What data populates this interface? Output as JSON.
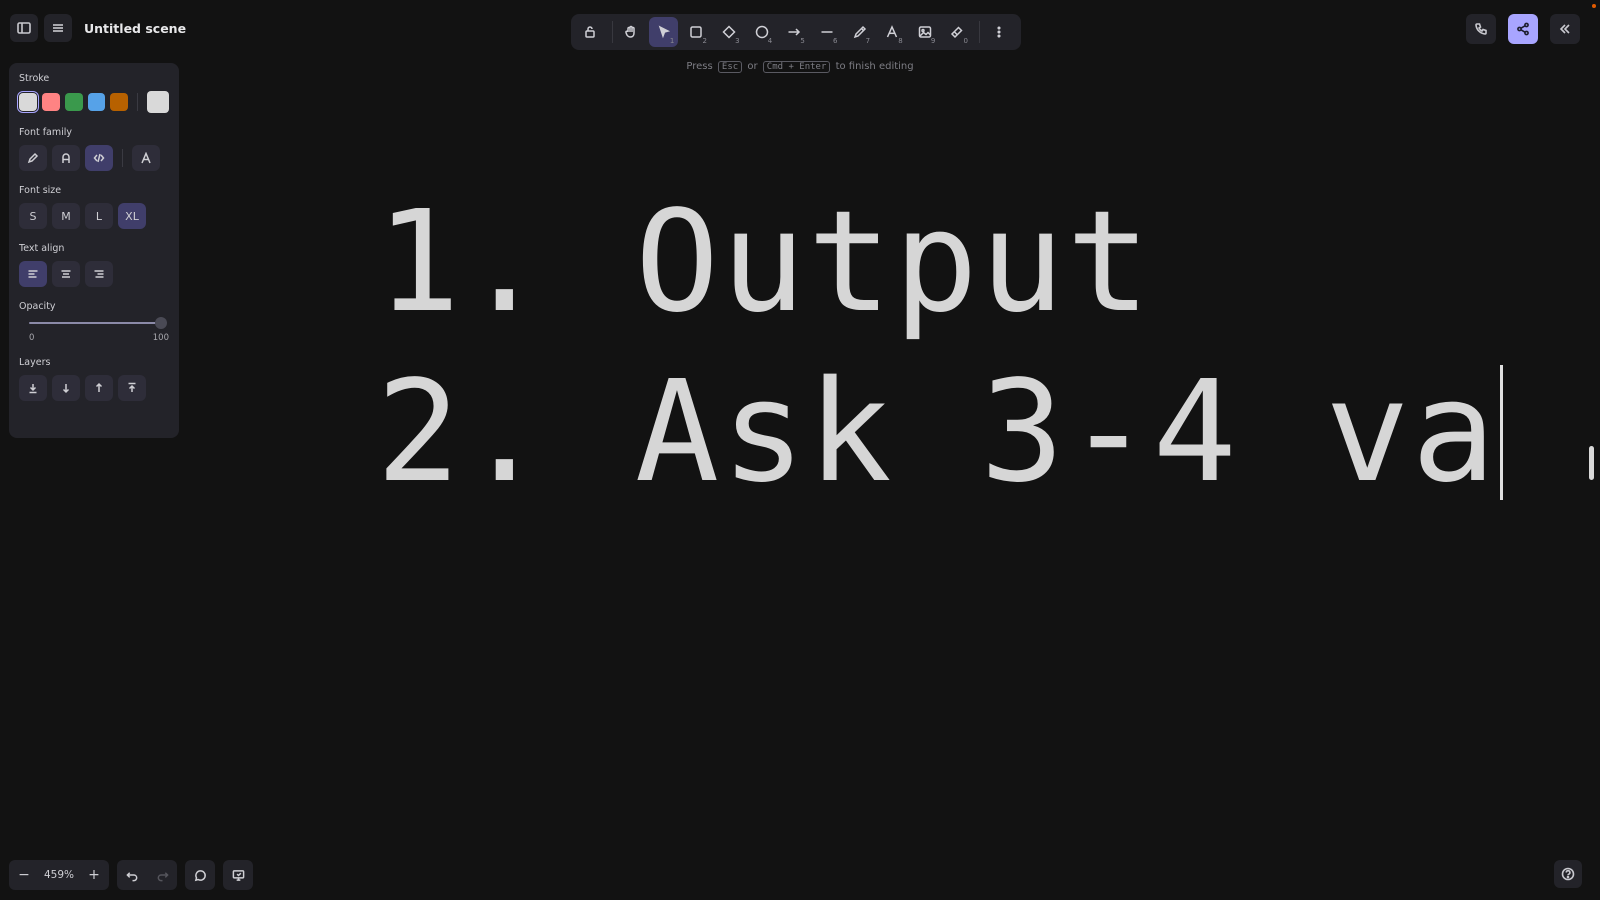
{
  "header": {
    "title": "Untitled scene"
  },
  "toolbar": {
    "tools": [
      {
        "name": "lock",
        "key": ""
      },
      {
        "name": "hand",
        "key": ""
      },
      {
        "name": "selection",
        "key": "1"
      },
      {
        "name": "rectangle",
        "key": "2"
      },
      {
        "name": "diamond",
        "key": "3"
      },
      {
        "name": "ellipse",
        "key": "4"
      },
      {
        "name": "arrow",
        "key": "5"
      },
      {
        "name": "line",
        "key": "6"
      },
      {
        "name": "draw",
        "key": "7"
      },
      {
        "name": "text",
        "key": "8"
      },
      {
        "name": "image",
        "key": "9"
      },
      {
        "name": "eraser",
        "key": "0"
      }
    ],
    "hint_press": "Press",
    "hint_esc": "Esc",
    "hint_or": "or",
    "hint_cmd": "Cmd + Enter",
    "hint_tail": "to finish editing"
  },
  "panel": {
    "stroke_label": "Stroke",
    "stroke_colors": [
      "#d9d9d9",
      "#ff8383",
      "#3a994c",
      "#56a2e8",
      "#b76100"
    ],
    "stroke_current": "#d9d9d9",
    "font_family_label": "Font family",
    "font_size_label": "Font size",
    "sizes": [
      "S",
      "M",
      "L",
      "XL"
    ],
    "text_align_label": "Text align",
    "opacity_label": "Opacity",
    "opacity_min": "0",
    "opacity_max": "100",
    "opacity_value": 100,
    "layers_label": "Layers"
  },
  "canvas": {
    "line1": "1. Output",
    "line2": "2. Ask 3-4 va"
  },
  "footer": {
    "zoom_out": "−",
    "zoom": "459%",
    "zoom_in": "+"
  }
}
